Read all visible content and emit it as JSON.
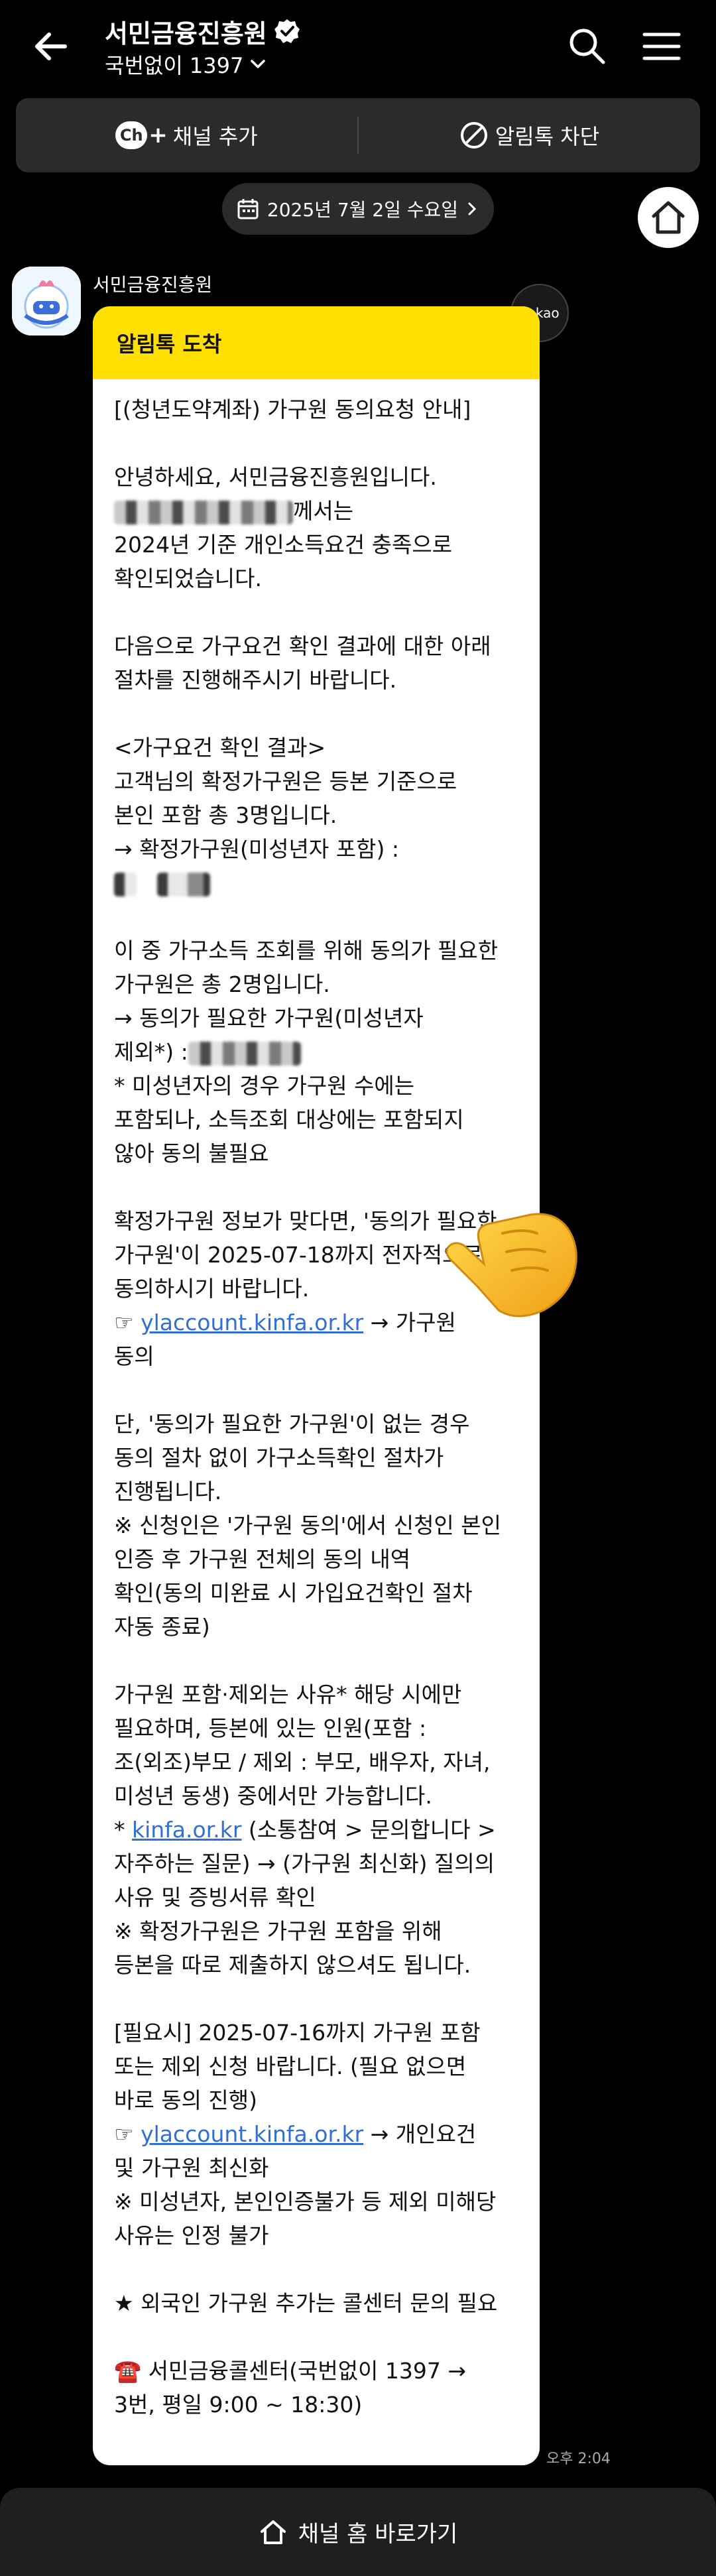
{
  "header": {
    "title": "서민금융진흥원",
    "subtitle": "국번없이 1397"
  },
  "actions": {
    "add_channel": "채널 추가",
    "add_channel_badge": "Ch",
    "block_alert": "알림톡 차단"
  },
  "date_pill": "2025년 7월 2일 수요일",
  "message": {
    "sender": "서민금융진흥원",
    "kakao_badge": "kakao",
    "header": "알림톡 도착",
    "p1": "[(청년도약계좌) 가구원 동의요청 안내]",
    "p2a": "안녕하세요, 서민금융진흥원입니다.",
    "p2b_suffix": "께서는",
    "p2c": "2024년 기준 개인소득요건 충족으로\n확인되었습니다.",
    "p3": "다음으로 가구요건 확인 결과에 대한 아래\n절차를 진행해주시기 바랍니다.",
    "p4": "<가구요건 확인 결과>\n고객님의 확정가구원은 등본 기준으로\n본인 포함 총 3명입니다.\n→ 확정가구원(미성년자 포함) :",
    "p5": "이 중 가구소득 조회를 위해 동의가 필요한\n가구원은 총 2명입니다.\n→ 동의가 필요한 가구원(미성년자\n제외*) :",
    "p5b": "* 미성년자의 경우 가구원 수에는\n포함되나, 소득조회 대상에는 포함되지\n않아 동의 불필요",
    "p6": "확정가구원 정보가 맞다면, '동의가 필요한\n가구원'이 2025-07-18까지 전자적으로\n동의하시기 바랍니다.",
    "p6_link_prefix": "☞ ",
    "p6_link": "ylaccount.kinfa.or.kr",
    "p6_link_suffix": " → 가구원\n동의",
    "p7": "단, '동의가 필요한 가구원'이 없는 경우\n동의 절차 없이 가구소득확인 절차가\n진행됩니다.\n※ 신청인은 '가구원 동의'에서 신청인 본인\n인증 후 가구원 전체의 동의 내역\n확인(동의 미완료 시 가입요건확인 절차\n자동 종료)",
    "p8": "가구원 포함·제외는 사유* 해당 시에만\n필요하며, 등본에 있는 인원(포함 :\n조(외조)부모 / 제외 : 부모, 배우자, 자녀,\n미성년 동생) 중에서만 가능합니다.",
    "p8_link_prefix": "* ",
    "p8_link": "kinfa.or.kr",
    "p8_link_suffix": " (소통참여 > 문의합니다 >\n자주하는 질문) → (가구원 최신화) 질의의\n사유 및 증빙서류 확인\n※ 확정가구원은 가구원 포함을 위해\n등본을 따로 제출하지 않으셔도 됩니다.",
    "p9": "[필요시] 2025-07-16까지 가구원 포함\n또는 제외 신청 바랍니다. (필요 없으면\n바로 동의 진행)",
    "p9_link_prefix": "☞ ",
    "p9_link": "ylaccount.kinfa.or.kr",
    "p9_link_suffix": " → 개인요건\n및 가구원 최신화\n※ 미성년자, 본인인증불가 등 제외 미해당\n사유는 인정 불가",
    "p10": "★ 외국인 가구원 추가는 콜센터 문의 필요",
    "p11": "☎️ 서민금융콜센터(국번없이 1397 →\n3번, 평일 9:00 ~ 18:30)",
    "time": "오후 2:04"
  },
  "bottom_bar": {
    "label": "채널 홈 바로가기"
  },
  "icons": {
    "back": "arrow-left-icon",
    "verified": "verified-check-icon",
    "search": "search-icon",
    "menu": "hamburger-menu-icon",
    "block": "block-icon",
    "calendar": "calendar-icon",
    "home": "home-icon",
    "hand": "pointing-hand-emoji"
  },
  "colors": {
    "background": "#000000",
    "bar": "#2b2b2b",
    "message_header": "#ffe000",
    "link": "#2f6fd6"
  }
}
